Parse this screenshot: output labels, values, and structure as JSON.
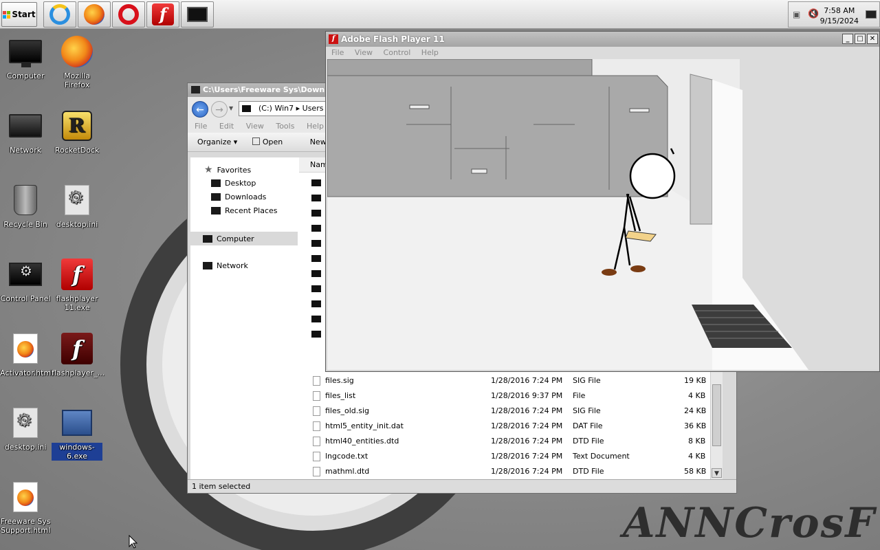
{
  "taskbar": {
    "start_label": "Start",
    "pinned": [
      {
        "name": "internet-explorer",
        "icon": "ie-icon"
      },
      {
        "name": "firefox",
        "icon": "firefox-icon"
      },
      {
        "name": "opera",
        "icon": "opera-icon"
      },
      {
        "name": "flash",
        "icon": "flash-icon"
      },
      {
        "name": "terminal",
        "icon": "terminal-icon"
      }
    ],
    "clock": {
      "time": "7:58 AM",
      "date": "9/15/2024"
    }
  },
  "desktop": {
    "icons": [
      {
        "label": "Computer",
        "icon": "monitor-icon"
      },
      {
        "label": "Mozilla Firefox",
        "icon": "firefox-icon"
      },
      {
        "label": "Network",
        "icon": "network-icon"
      },
      {
        "label": "RocketDock",
        "icon": "rocketdock-icon"
      },
      {
        "label": "Recycle Bin",
        "icon": "recycle-bin-icon"
      },
      {
        "label": "desktop.ini",
        "icon": "settings-file-icon"
      },
      {
        "label": "Control Panel",
        "icon": "control-panel-icon"
      },
      {
        "label": "flashplayer 11.exe",
        "icon": "flash-icon"
      },
      {
        "label": "Activator.html",
        "icon": "html-file-icon"
      },
      {
        "label": "flashplayer_...",
        "icon": "flash-icon"
      },
      {
        "label": "desktop.ini",
        "icon": "settings-file-icon"
      },
      {
        "label": "windows-6.exe",
        "icon": "app-icon"
      },
      {
        "label": "Freeware Sys Support.html",
        "icon": "html-file-icon"
      }
    ],
    "watermark": "ANNCrosF"
  },
  "explorer": {
    "title": "C:\\Users\\Freeware Sys\\Downlo",
    "address": "(C:) Win7 ▸ Users",
    "menu": [
      "File",
      "Edit",
      "View",
      "Tools",
      "Help"
    ],
    "commands": [
      "Organize ▾",
      "Open",
      "New folde"
    ],
    "nav": {
      "favorites": "Favorites",
      "desktop": "Desktop",
      "downloads": "Downloads",
      "recent": "Recent Places",
      "computer": "Computer",
      "network": "Network"
    },
    "column_name": "Nam",
    "files": [
      {
        "name": "files.sig",
        "date": "1/28/2016 7:24 PM",
        "type": "SIG File",
        "size": "19 KB"
      },
      {
        "name": "files_list",
        "date": "1/28/2016 9:37 PM",
        "type": "File",
        "size": "4 KB"
      },
      {
        "name": "files_old.sig",
        "date": "1/28/2016 7:24 PM",
        "type": "SIG File",
        "size": "24 KB"
      },
      {
        "name": "html5_entity_init.dat",
        "date": "1/28/2016 7:24 PM",
        "type": "DAT File",
        "size": "36 KB"
      },
      {
        "name": "html40_entities.dtd",
        "date": "1/28/2016 7:24 PM",
        "type": "DTD File",
        "size": "8 KB"
      },
      {
        "name": "lngcode.txt",
        "date": "1/28/2016 7:24 PM",
        "type": "Text Document",
        "size": "4 KB"
      },
      {
        "name": "mathml.dtd",
        "date": "1/28/2016 7:24 PM",
        "type": "DTD File",
        "size": "58 KB"
      }
    ],
    "status": "1 item selected"
  },
  "flash_player": {
    "title": "Adobe Flash Player 11",
    "menu": [
      "File",
      "View",
      "Control",
      "Help"
    ],
    "controls": {
      "minimize": "_",
      "maximize": "□",
      "close": "✕"
    }
  },
  "colors": {
    "selection": "#1e3f95",
    "flash_red": "#cc1111",
    "wallpaper": "#8e8e8e"
  }
}
